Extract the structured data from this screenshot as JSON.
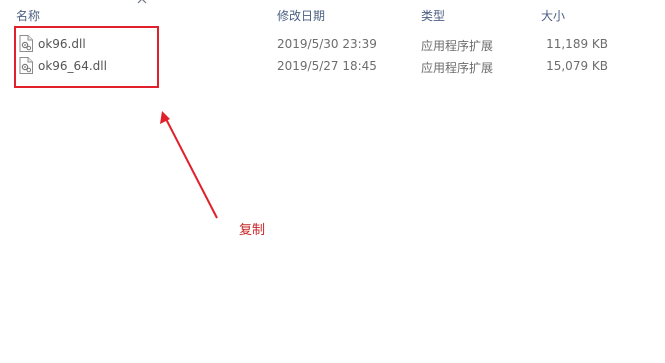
{
  "columns": {
    "name": "名称",
    "date": "修改日期",
    "type": "类型",
    "size": "大小"
  },
  "files": [
    {
      "name": "ok96.dll",
      "date": "2019/5/30 23:39",
      "type": "应用程序扩展",
      "size": "11,189 KB",
      "icon": "dll-file-icon"
    },
    {
      "name": "ok96_64.dll",
      "date": "2019/5/27 18:45",
      "type": "应用程序扩展",
      "size": "15,079 KB",
      "icon": "dll-file-icon"
    }
  ],
  "annotation": {
    "label": "复制",
    "color": "#e0202a"
  },
  "icons": {
    "sort": "chevron-up-icon",
    "file": "dll-file-icon"
  }
}
